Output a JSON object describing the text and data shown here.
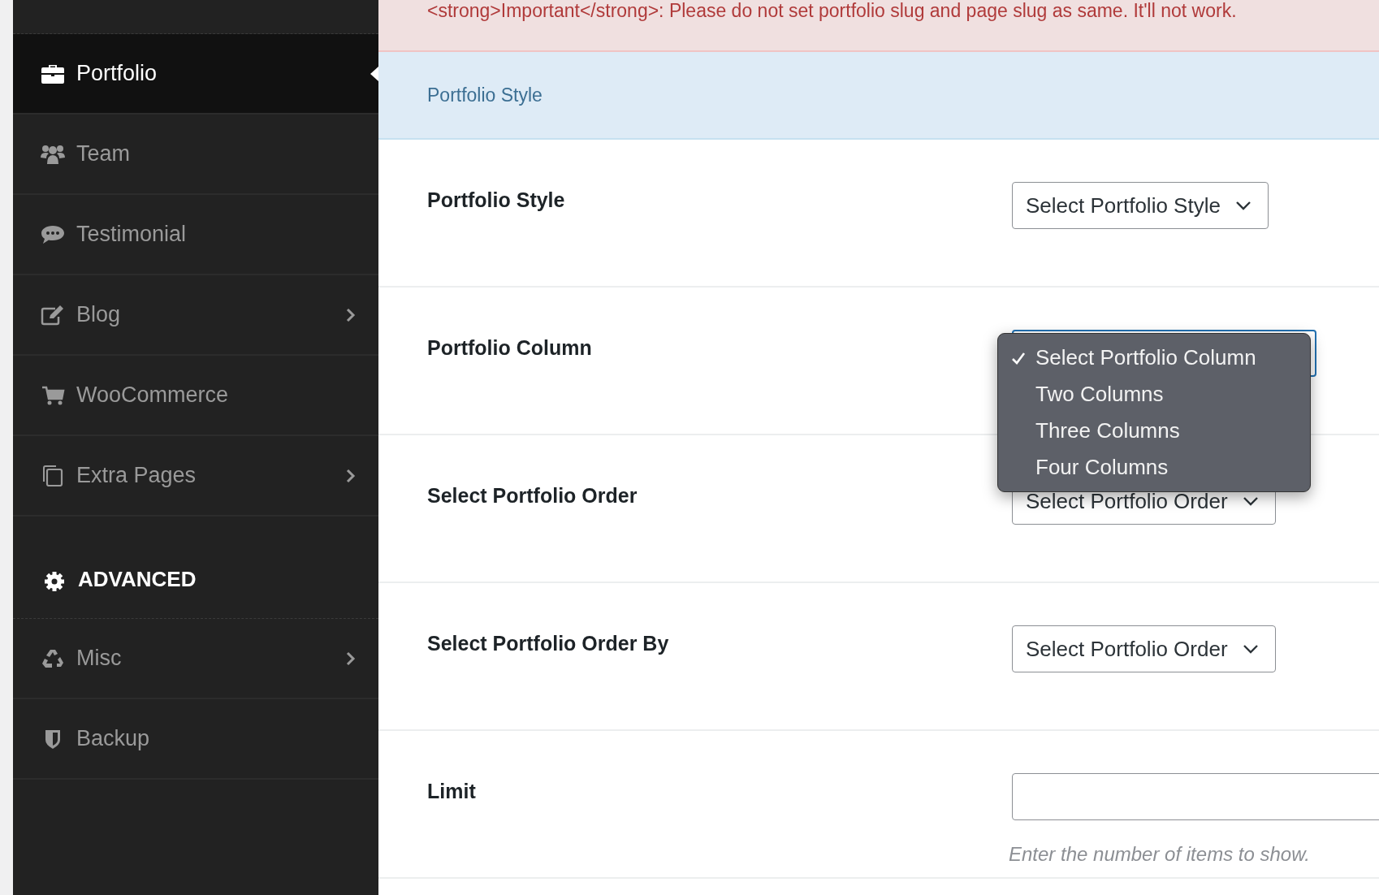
{
  "sidebar": {
    "items": [
      {
        "kind": "item",
        "label": "Portfolio",
        "selected": true,
        "submenu": false
      },
      {
        "kind": "item",
        "label": "Team",
        "selected": false,
        "submenu": false
      },
      {
        "kind": "item",
        "label": "Testimonial",
        "selected": false,
        "submenu": false
      },
      {
        "kind": "item",
        "label": "Blog",
        "selected": false,
        "submenu": true
      },
      {
        "kind": "item",
        "label": "WooCommerce",
        "selected": false,
        "submenu": false
      },
      {
        "kind": "item",
        "label": "Extra Pages",
        "selected": false,
        "submenu": true
      },
      {
        "kind": "heading",
        "label": "ADVANCED"
      },
      {
        "kind": "item",
        "label": "Misc",
        "selected": false,
        "submenu": true
      },
      {
        "kind": "item",
        "label": "Backup",
        "selected": false,
        "submenu": false
      }
    ]
  },
  "notice": "<strong>Important</strong>: Please do not set portfolio slug and page slug as same. It'll not work.",
  "section_title": "Portfolio Style",
  "fields": [
    {
      "kind": "select",
      "label": "Portfolio Style",
      "value": "Select Portfolio Style",
      "open": false
    },
    {
      "kind": "select",
      "label": "Portfolio Column",
      "open": true,
      "options": [
        {
          "label": "Select Portfolio Column",
          "selected": true
        },
        {
          "label": "Two Columns",
          "selected": false
        },
        {
          "label": "Three Columns",
          "selected": false
        },
        {
          "label": "Four Columns",
          "selected": false
        }
      ]
    },
    {
      "kind": "select",
      "label": "Select Portfolio Order",
      "value": "Select Portfolio Order",
      "open": false
    },
    {
      "kind": "select",
      "label": "Select Portfolio Order By",
      "value": "Select Portfolio Order",
      "open": false
    },
    {
      "kind": "text",
      "label": "Limit",
      "hint": "Enter the number of items to show."
    }
  ]
}
